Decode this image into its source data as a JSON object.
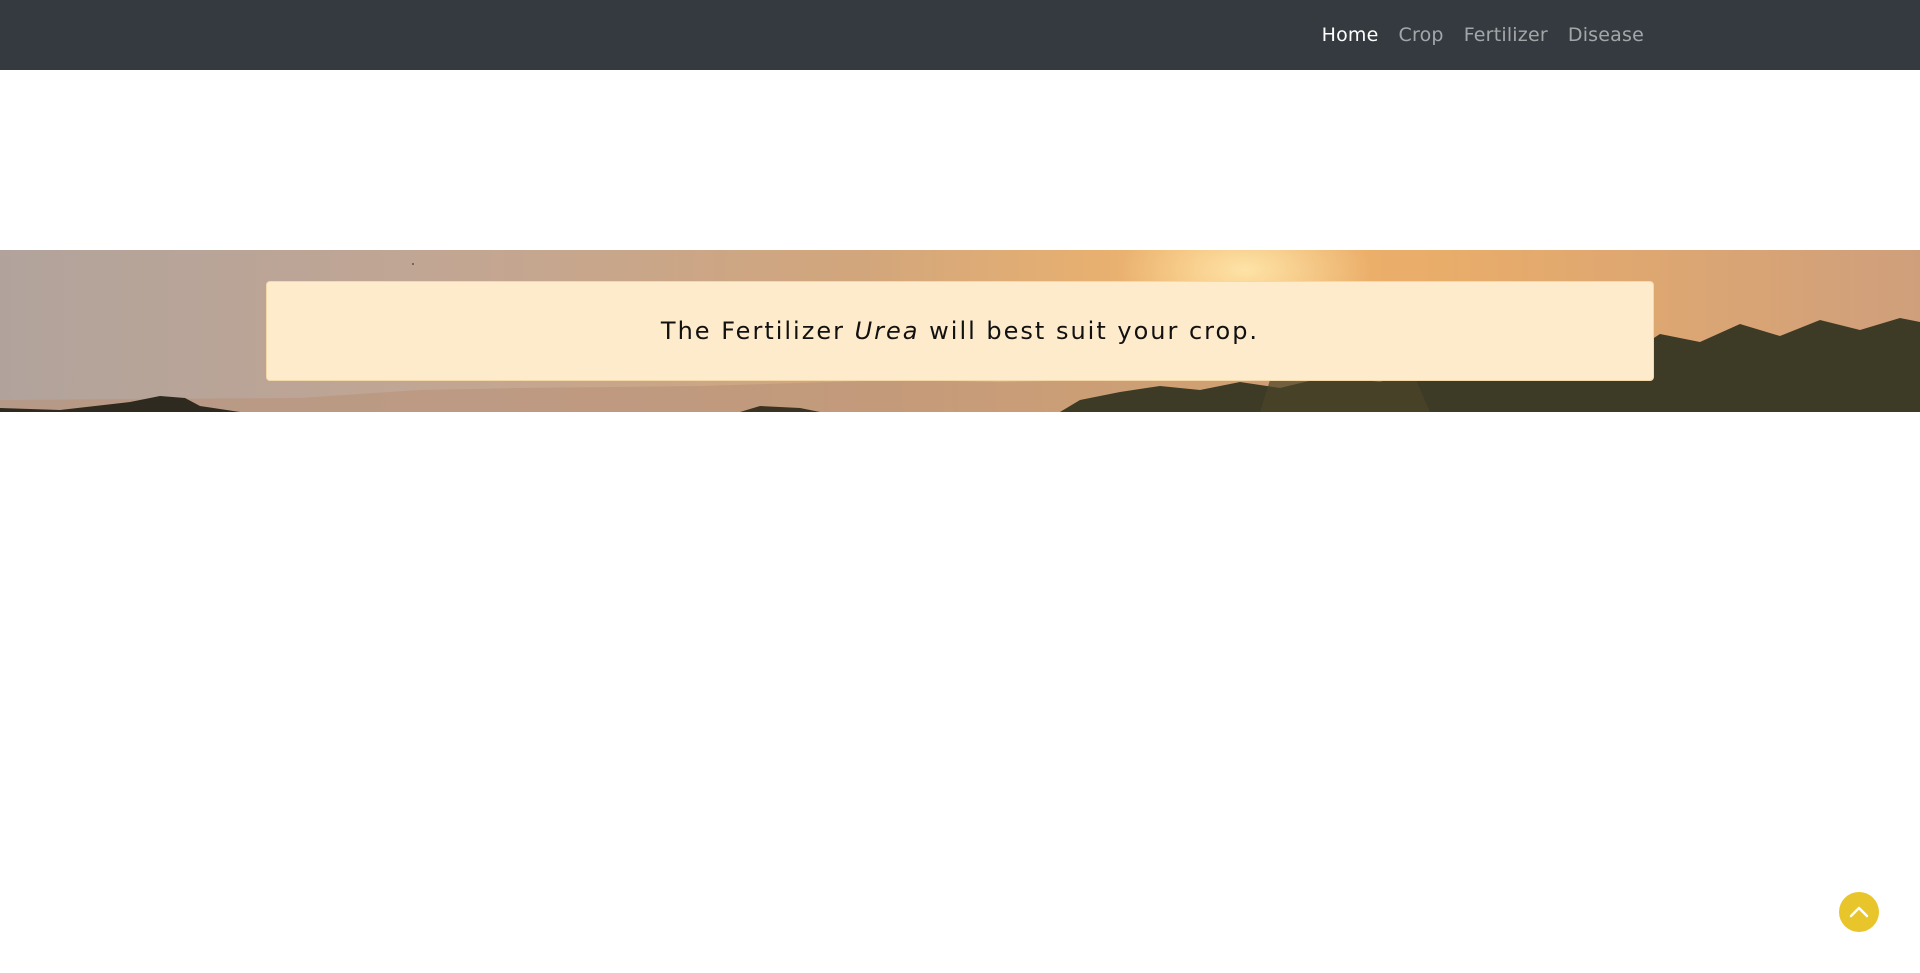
{
  "navbar": {
    "items": [
      {
        "label": "Home",
        "active": true
      },
      {
        "label": "Crop",
        "active": false
      },
      {
        "label": "Fertilizer",
        "active": false
      },
      {
        "label": "Disease",
        "active": false
      }
    ]
  },
  "result": {
    "prefix": "The Fertilizer",
    "fertilizer": "Urea",
    "suffix": "will best suit your crop."
  },
  "scroll_top": {
    "icon": "chevron-up-icon",
    "color": "#e8c52a"
  },
  "colors": {
    "navbar_bg": "#343a40",
    "alert_bg": "#feebcc"
  }
}
